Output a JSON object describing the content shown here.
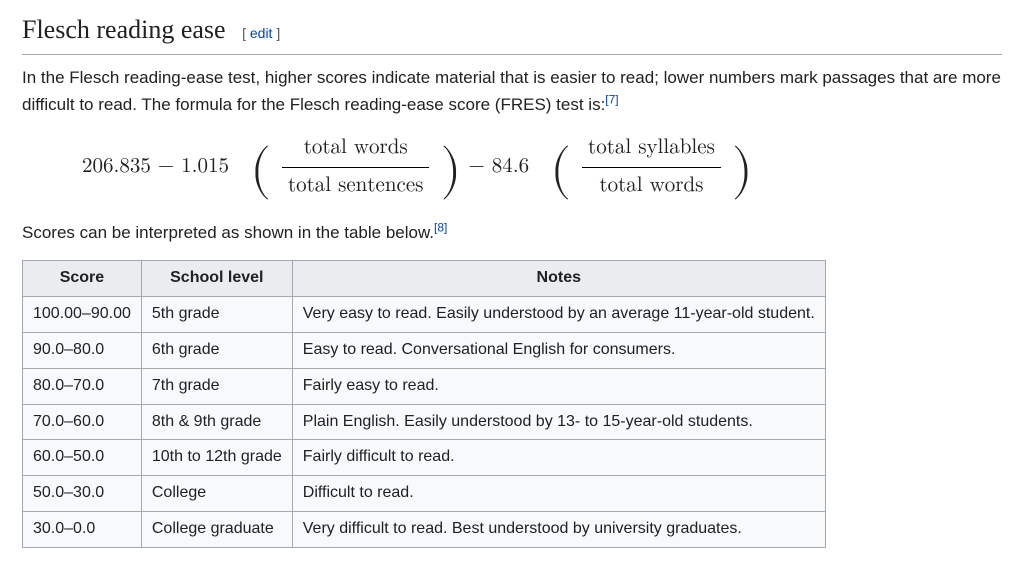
{
  "heading": {
    "title": "Flesch reading ease",
    "edit_open": "[ ",
    "edit_link": "edit",
    "edit_close": " ]"
  },
  "intro": {
    "text": "In the Flesch reading-ease test, higher scores indicate material that is easier to read; lower numbers mark passages that are more difficult to read. The formula for the Flesch reading-ease score (FRES) test is:",
    "ref": "[7]"
  },
  "formula": {
    "c1": "206.835",
    "minus": " − ",
    "c2": "1.015",
    "frac1_num": "total words",
    "frac1_den": "total sentences",
    "c3": "84.6",
    "frac2_num": "total syllables",
    "frac2_den": "total words",
    "lp": "(",
    "rp": ")"
  },
  "interpret": {
    "text": "Scores can be interpreted as shown in the table below.",
    "ref": "[8]"
  },
  "table": {
    "headers": {
      "score": "Score",
      "level": "School level",
      "notes": "Notes"
    },
    "rows": [
      {
        "score": "100.00–90.00",
        "level": "5th grade",
        "notes": "Very easy to read. Easily understood by an average 11-year-old student."
      },
      {
        "score": "90.0–80.0",
        "level": "6th grade",
        "notes": "Easy to read. Conversational English for consumers."
      },
      {
        "score": "80.0–70.0",
        "level": "7th grade",
        "notes": "Fairly easy to read."
      },
      {
        "score": "70.0–60.0",
        "level": "8th & 9th grade",
        "notes": "Plain English. Easily understood by 13- to 15-year-old students."
      },
      {
        "score": "60.0–50.0",
        "level": "10th to 12th grade",
        "notes": "Fairly difficult to read."
      },
      {
        "score": "50.0–30.0",
        "level": "College",
        "notes": "Difficult to read."
      },
      {
        "score": "30.0–0.0",
        "level": "College graduate",
        "notes": "Very difficult to read. Best understood by university graduates."
      }
    ]
  }
}
